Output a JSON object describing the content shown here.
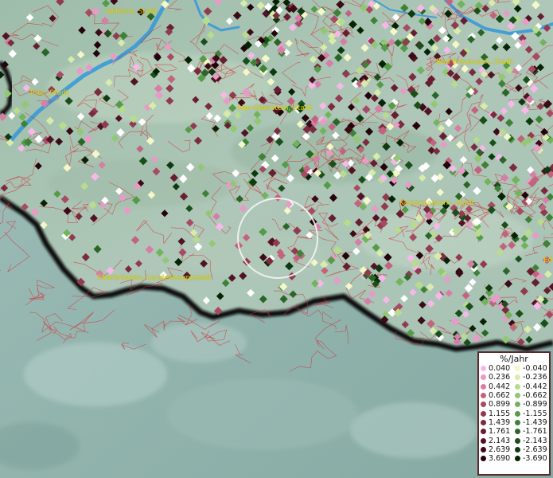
{
  "map": {
    "cities": [
      {
        "name": "Wittlich, Stadt"
      },
      {
        "name": "Bad Kreuznach, Stadt"
      },
      {
        "name": "Trier, Stadt"
      },
      {
        "name": "Idar-Oberstein, Stadt"
      },
      {
        "name": "Kaiserslautern, Stadt"
      },
      {
        "name": "Saarbrücken, Landeshauptstadt"
      },
      {
        "name": "Ed"
      }
    ],
    "colors": {
      "water": "#3a9ad8",
      "boundary": "#d2323c",
      "outline": "#111111",
      "label": "#e8d800",
      "outside_area": "#8fb3ad",
      "inside_area": "#a9c4b8"
    }
  },
  "legend": {
    "title": "%/Jahr",
    "positive": [
      {
        "value": "0.040",
        "color": "#f6b8e8"
      },
      {
        "value": "0.236",
        "color": "#e79bc6"
      },
      {
        "value": "0.442",
        "color": "#d77ea6"
      },
      {
        "value": "0.662",
        "color": "#c2647f"
      },
      {
        "value": "0.899",
        "color": "#a84a63"
      },
      {
        "value": "1.155",
        "color": "#923a50"
      },
      {
        "value": "1.439",
        "color": "#7c2b3f"
      },
      {
        "value": "1.761",
        "color": "#681e31"
      },
      {
        "value": "2.143",
        "color": "#531324"
      },
      {
        "value": "2.639",
        "color": "#3d0a18"
      },
      {
        "value": "3.690",
        "color": "#24030c"
      }
    ],
    "negative": [
      {
        "value": "-0.040",
        "color": "#f4f8c8"
      },
      {
        "value": "-0.236",
        "color": "#d8ecaa"
      },
      {
        "value": "-0.442",
        "color": "#b7dd8c"
      },
      {
        "value": "-0.662",
        "color": "#93c873"
      },
      {
        "value": "-0.899",
        "color": "#72b35c"
      },
      {
        "value": "-1.155",
        "color": "#559b48"
      },
      {
        "value": "-1.439",
        "color": "#3d8236"
      },
      {
        "value": "-1.761",
        "color": "#2a6727"
      },
      {
        "value": "-2.143",
        "color": "#1a4f1a"
      },
      {
        "value": "-2.639",
        "color": "#0e3a10"
      },
      {
        "value": "-3.690",
        "color": "#062405"
      }
    ]
  }
}
